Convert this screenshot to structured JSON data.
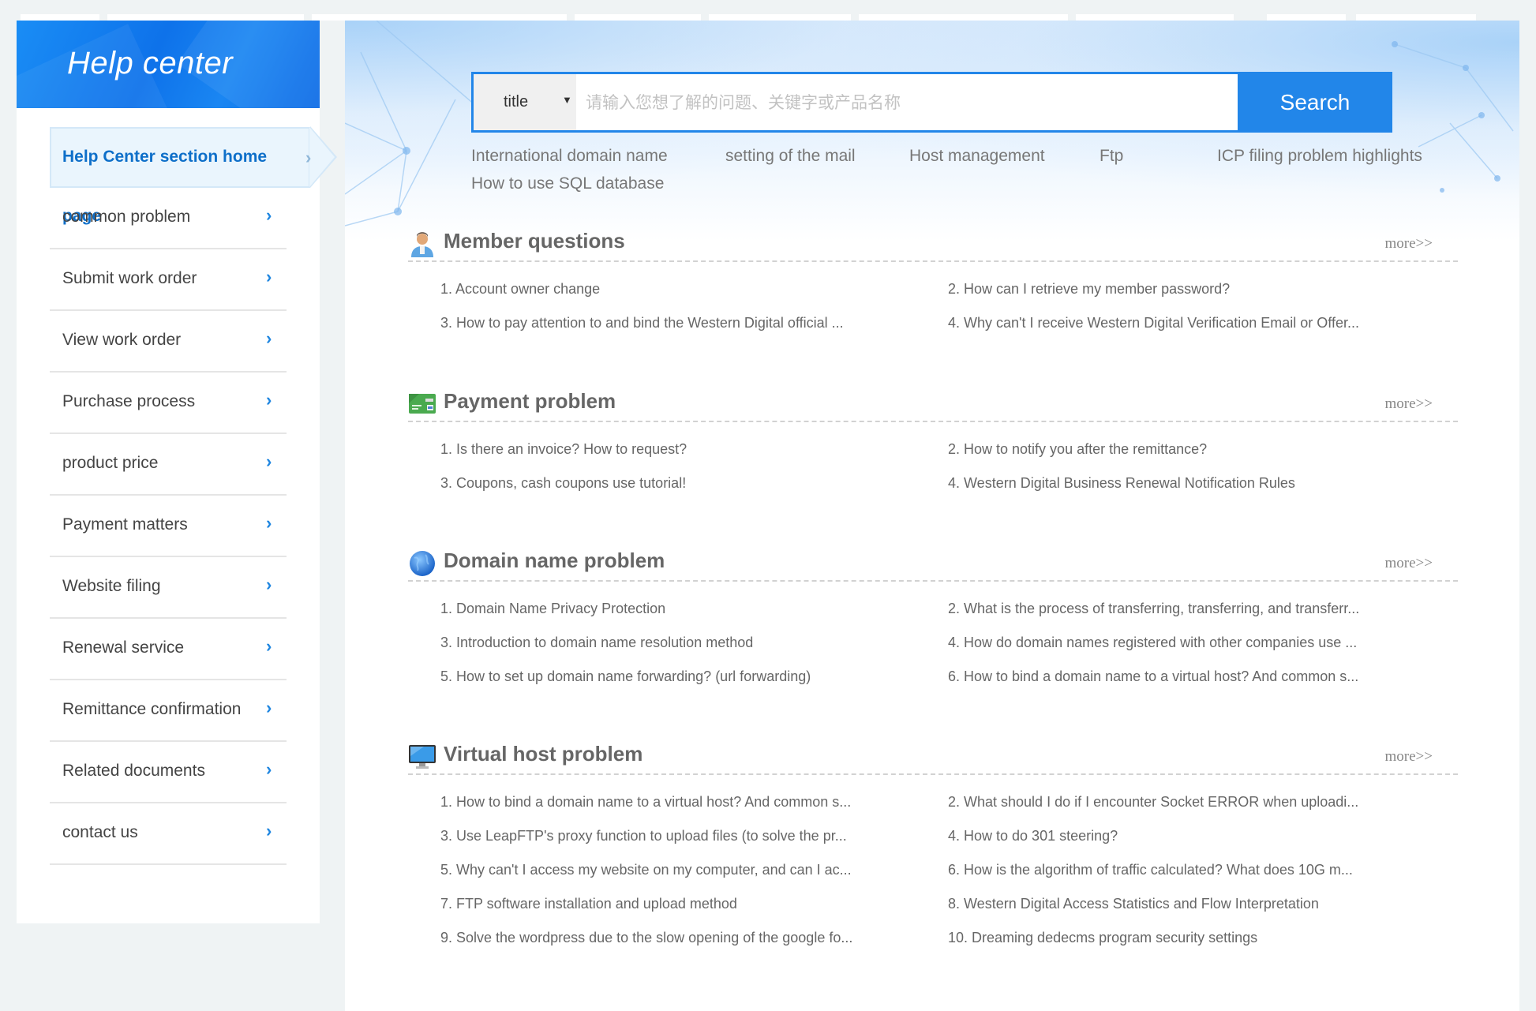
{
  "sidebar": {
    "title": "Help center",
    "items": [
      {
        "label": "Help Center section home page",
        "active": true
      },
      {
        "label": "common problem"
      },
      {
        "label": "Submit work order"
      },
      {
        "label": "View work order"
      },
      {
        "label": "Purchase process"
      },
      {
        "label": "product price"
      },
      {
        "label": "Payment matters"
      },
      {
        "label": "Website filing"
      },
      {
        "label": "Renewal service"
      },
      {
        "label": "Remittance confirmation"
      },
      {
        "label": "Related documents"
      },
      {
        "label": "contact us"
      }
    ]
  },
  "search": {
    "select_value": "title",
    "placeholder": "请输入您想了解的问题、关键字或产品名称",
    "value": "",
    "button": "Search"
  },
  "quick_links": [
    "International domain name",
    "setting of the mail",
    "Host management",
    "Ftp",
    "ICP filing problem highlights",
    "How to use SQL database"
  ],
  "sections": [
    {
      "icon": "user-icon",
      "title": "Member questions",
      "more": "more>>",
      "items": [
        "1. Account owner change",
        "2. How can I retrieve my member password?",
        "3. How to pay attention to and bind the Western Digital official ...",
        "4. Why can't I receive Western Digital Verification Email or Offer..."
      ]
    },
    {
      "icon": "credit-card-icon",
      "title": "Payment problem",
      "more": "more>>",
      "items": [
        "1. Is there an invoice? How to request?",
        "2. How to notify you after the remittance?",
        "3. Coupons, cash coupons use tutorial!",
        "4. Western Digital Business Renewal Notification Rules"
      ]
    },
    {
      "icon": "globe-icon",
      "title": "Domain name problem",
      "more": "more>>",
      "items": [
        "1. Domain Name Privacy Protection",
        "2. What is the process of transferring, transferring, and transferr...",
        "3. Introduction to domain name resolution method",
        "4. How do domain names registered with other companies use ...",
        "5. How to set up domain name forwarding? (url forwarding)",
        "6. How to bind a domain name to a virtual host? And common s..."
      ]
    },
    {
      "icon": "monitor-icon",
      "title": "Virtual host problem",
      "more": "more>>",
      "items": [
        "1. How to bind a domain name to a virtual host? And common s...",
        "2. What should I do if I encounter Socket ERROR when uploadi...",
        "3. Use LeapFTP's proxy function to upload files (to solve the pr...",
        "4. How to do 301 steering?",
        "5. Why can't I access my website on my computer, and can I ac...",
        "6. How is the algorithm of traffic calculated? What does 10G m...",
        "7. FTP software installation and upload method",
        "8. Western Digital Access Statistics and Flow Interpretation",
        "9. Solve the wordpress due to the slow opening of the google fo...",
        "10. Dreaming dedecms program security settings"
      ]
    }
  ],
  "colors": {
    "brand_blue": "#2286e9",
    "active_text": "#0e6fc9",
    "page_bg": "#eff3f4"
  }
}
